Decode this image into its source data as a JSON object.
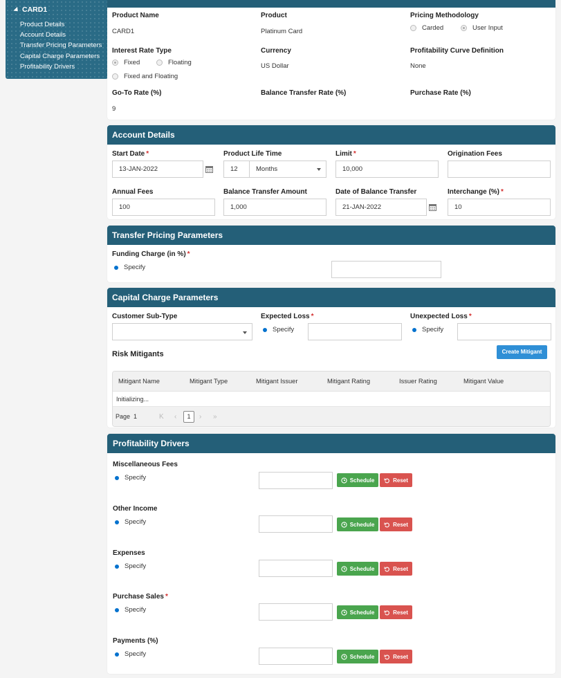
{
  "sidebar": {
    "root": "CARD1",
    "items": [
      "Product Details",
      "Account Details",
      "Transfer Pricing Parameters",
      "Capital Charge Parameters",
      "Profitability Drivers"
    ]
  },
  "product": {
    "product_name_label": "Product Name",
    "product_name_value": "CARD1",
    "product_label": "Product",
    "product_value": "Platinum Card",
    "pricing_methodology_label": "Pricing Methodology",
    "pricing_options": [
      "Carded",
      "User Input"
    ],
    "interest_rate_type_label": "Interest Rate Type",
    "interest_rate_options": [
      "Fixed",
      "Floating",
      "Fixed and Floating"
    ],
    "currency_label": "Currency",
    "currency_value": "US Dollar",
    "profitability_curve_label": "Profitability Curve Definition",
    "profitability_curve_value": "None",
    "goto_rate_label": "Go-To Rate (%)",
    "goto_rate_value": "9",
    "balance_transfer_rate_label": "Balance Transfer Rate (%)",
    "purchase_rate_label": "Purchase Rate (%)"
  },
  "account": {
    "title": "Account Details",
    "start_date_label": "Start Date",
    "start_date_value": "13-JAN-2022",
    "product_life_label": "Product Life Time",
    "product_life_value": "12",
    "product_life_unit": "Months",
    "limit_label": "Limit",
    "limit_value": "10,000",
    "origination_fees_label": "Origination Fees",
    "annual_fees_label": "Annual Fees",
    "annual_fees_value": "100",
    "balance_transfer_amount_label": "Balance Transfer Amount",
    "balance_transfer_amount_value": "1,000",
    "date_of_balance_transfer_label": "Date of Balance Transfer",
    "date_of_balance_transfer_value": "21-JAN-2022",
    "interchange_label": "Interchange (%)",
    "interchange_value": "10"
  },
  "transfer": {
    "title": "Transfer Pricing Parameters",
    "funding_charge_label": "Funding Charge (in %)",
    "specify": "Specify"
  },
  "capital": {
    "title": "Capital Charge Parameters",
    "customer_subtype_label": "Customer Sub-Type",
    "expected_loss_label": "Expected Loss",
    "unexpected_loss_label": "Unexpected Loss",
    "specify": "Specify",
    "risk_mitigants_label": "Risk Mitigants",
    "create_mitigant": "Create Mitigant",
    "columns": [
      "Mitigant Name",
      "Mitigant Type",
      "Mitigant Issuer",
      "Mitigant Rating",
      "Issuer Rating",
      "Mitigant Value"
    ],
    "status": "Initializing...",
    "page_label": "Page",
    "page_value": "1",
    "current_page": "1",
    "pager_first": "K",
    "pager_prev": "‹",
    "pager_next": "›",
    "pager_last": "»"
  },
  "drivers": {
    "title": "Profitability Drivers",
    "specify": "Specify",
    "schedule": "Schedule",
    "reset": "Reset",
    "items": [
      "Miscellaneous Fees",
      "Other Income",
      "Expenses",
      "Purchase Sales",
      "Payments (%)"
    ]
  },
  "colors": {
    "header": "#245f78",
    "sidebar": "#2a6b86",
    "schedule": "#4aa54e",
    "reset": "#d9534f",
    "primary": "#2f8fd6",
    "required": "#d32f2f"
  }
}
